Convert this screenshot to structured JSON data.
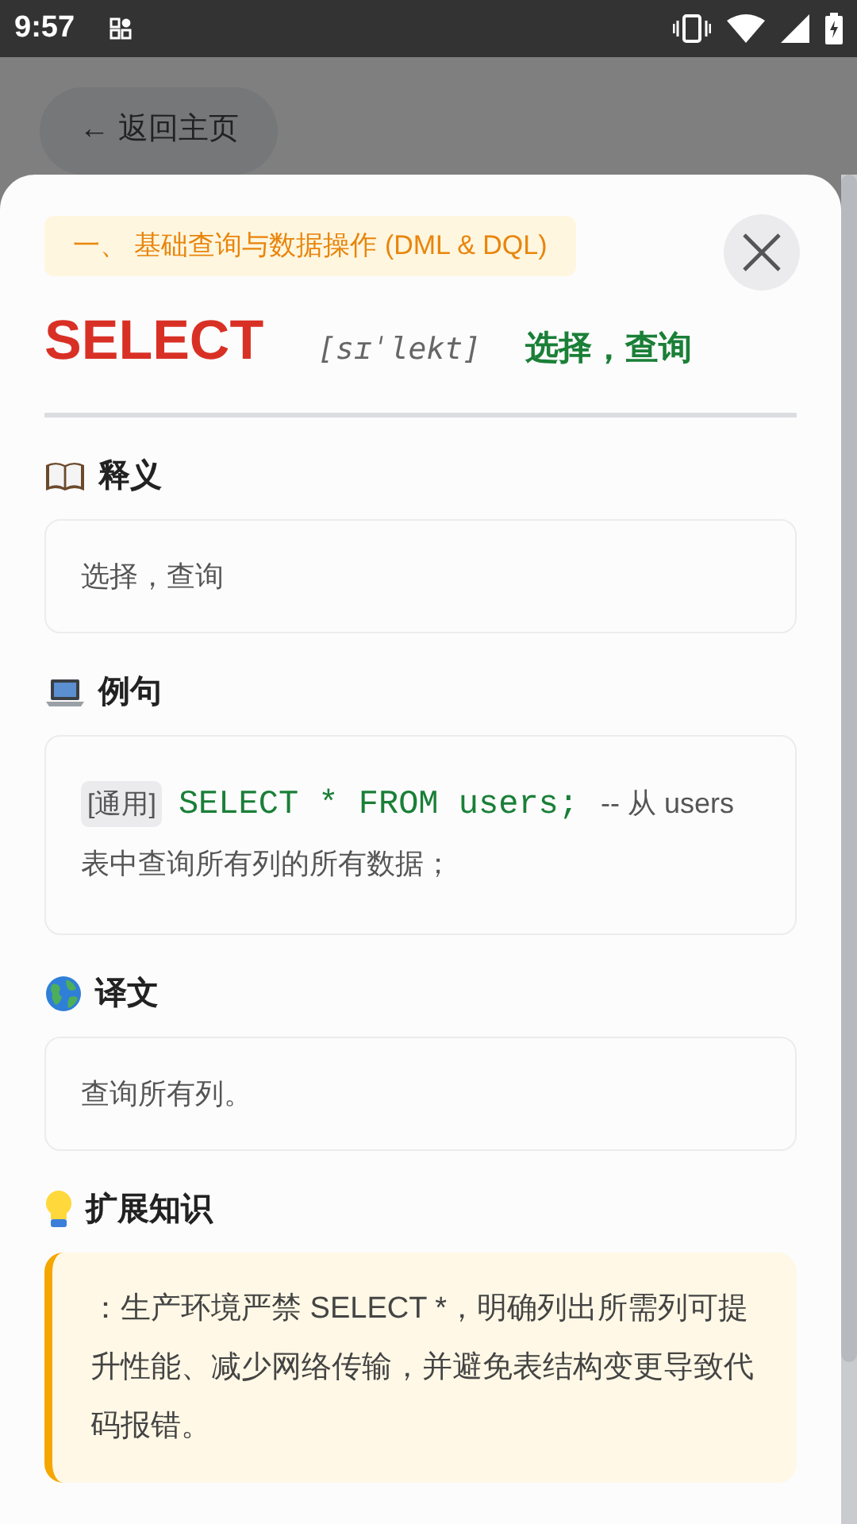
{
  "status_bar": {
    "time": "9:57"
  },
  "back_button": {
    "label": "← 返回主页"
  },
  "category": "一、 基础查询与数据操作 (DML & DQL)",
  "word": {
    "term": "SELECT",
    "phonetic": "[sɪˈlekt]",
    "meaning": "选择，查询"
  },
  "sections": [
    {
      "kind": "definition",
      "heading": "释义",
      "text": "选择，查询"
    },
    {
      "kind": "example",
      "heading": "例句",
      "tag": "[通用]",
      "code": "SELECT * FROM users;",
      "comment": "-- 从 users 表中查询所有列的所有数据；"
    },
    {
      "kind": "translation",
      "heading": "译文",
      "text": "查询所有列。"
    },
    {
      "kind": "tip",
      "heading": "扩展知识",
      "text": "：生产环境严禁 SELECT *，明确列出所需列可提升性能、减少网络传输，并避免表结构变更导致代码报错。"
    }
  ]
}
